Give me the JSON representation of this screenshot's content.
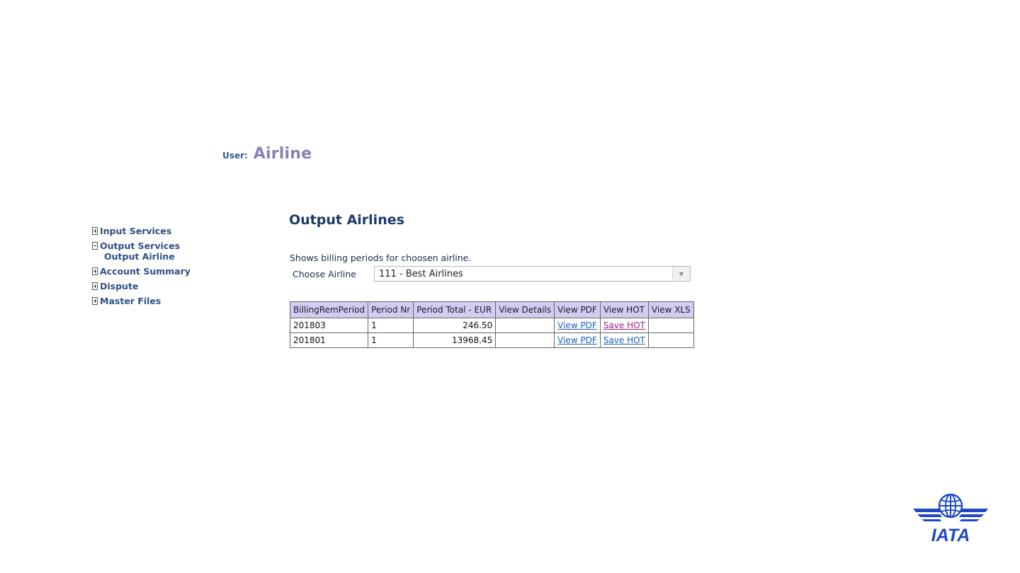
{
  "user": {
    "label": "User:",
    "name": "Airline"
  },
  "sidebar": {
    "items": [
      {
        "label": "Input Services",
        "expanded": false
      },
      {
        "label": "Output Services",
        "expanded": true,
        "children": [
          {
            "label": "Output Airline"
          }
        ]
      },
      {
        "label": "Account Summary",
        "expanded": false
      },
      {
        "label": "Dispute",
        "expanded": false
      },
      {
        "label": "Master Files",
        "expanded": false
      }
    ]
  },
  "main": {
    "title": "Output Airlines",
    "description": "Shows billing periods for choosen airline.",
    "choose_label": "Choose Airline",
    "selected_airline": "111 - Best Airlines"
  },
  "table": {
    "headers": [
      "BillingRemPeriod",
      "Period Nr",
      "Period Total - EUR",
      "View Details",
      "View PDF",
      "View HOT",
      "View XLS"
    ],
    "rows": [
      {
        "period": "201803",
        "nr": "1",
        "total": "246.50",
        "details": "",
        "pdf": "View PDF",
        "hot": "Save HOT",
        "xls": ""
      },
      {
        "period": "201801",
        "nr": "1",
        "total": "13968.45",
        "details": "",
        "pdf": "View PDF",
        "hot": "Save HOT",
        "xls": ""
      }
    ]
  },
  "logo": {
    "text": "IATA",
    "color": "#1f47c8"
  },
  "colors": {
    "header_bg": "#d1cdf1",
    "link": "#1f5fc4",
    "visited_link": "#a0208c",
    "title": "#1d3a6b"
  }
}
